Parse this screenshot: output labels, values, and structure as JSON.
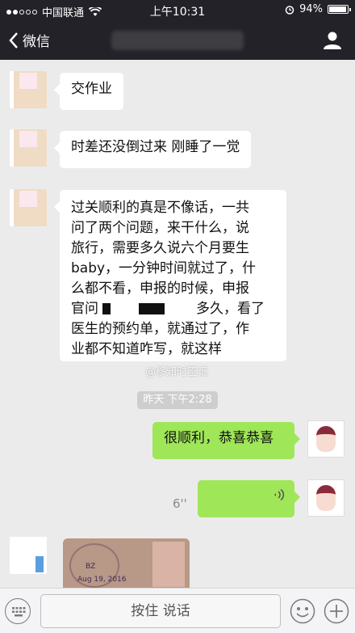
{
  "status_bar": {
    "carrier": "中国联通",
    "time": "上午10:31",
    "battery": "94%",
    "battery_level": 0.94
  },
  "nav": {
    "back_label": "微信"
  },
  "messages": {
    "m1": "交作业",
    "m2": "时差还没倒过来 刚睡了一觉",
    "m3_line1": "过关顺利的真是不像话，一共",
    "m3_line2": "问了两个问题，来干什么，说",
    "m3_line3": "旅行，需要多久说六个月要生",
    "m3_line4": "baby，一分钟时间就过了，什",
    "m3_line5": "么都不看，申报的时候，申报",
    "m3_line6a": "官问",
    "m3_line6b": "多久，看了",
    "m3_line7": "医生的预约单，就通过了，作",
    "m3_line8": "业都不知道咋写，就这样",
    "timestamp": "昨天 下午2:28",
    "reply": "很顺利，恭喜恭喜",
    "voice_duration": "6''",
    "image_stamp_letters": "BZ",
    "image_stamp_date": "Aug 19, 2016"
  },
  "watermark": "@移知时签证",
  "input_bar": {
    "hold_to_talk": "按住 说话"
  },
  "colors": {
    "header_bg": "#232228",
    "chat_bg": "#ebebeb",
    "my_bubble": "#9fe658",
    "their_bubble": "#ffffff"
  },
  "icons": [
    "wifi-icon",
    "alarm-icon",
    "back-chevron-icon",
    "profile-icon",
    "voice-wave-icon",
    "keyboard-icon",
    "emoji-icon",
    "plus-icon"
  ]
}
